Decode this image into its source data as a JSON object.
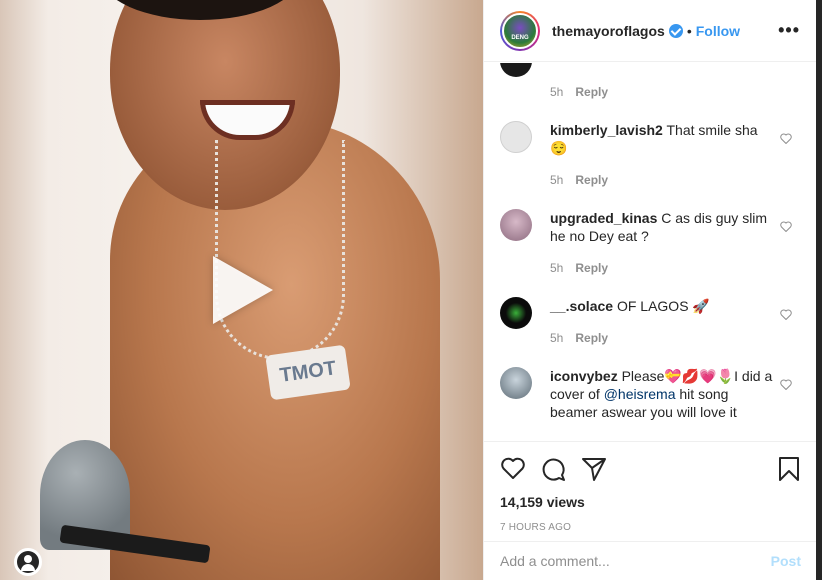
{
  "header": {
    "username": "themayoroflagos",
    "dot": "•",
    "follow_label": "Follow",
    "more_label": "•••",
    "avatar_text": "DENG"
  },
  "media": {
    "pendant_text": "TMOT"
  },
  "comments": [
    {
      "username": "",
      "text": "_",
      "time": "5h",
      "reply": "Reply"
    },
    {
      "username": "kimberly_lavish2",
      "text": "That smile sha 😌",
      "time": "5h",
      "reply": "Reply"
    },
    {
      "username": "upgraded_kinas",
      "text": "C as dis guy slim he no Dey eat ?",
      "time": "5h",
      "reply": "Reply"
    },
    {
      "username": "__.solace",
      "text": "OF LAGOS 🚀",
      "time": "5h",
      "reply": "Reply"
    },
    {
      "username": "iconvybez",
      "text_before": "Please💝💋💗🌷I did a cover of ",
      "mention": "@heisrema",
      "text_after": " hit song beamer aswear you will love it"
    }
  ],
  "stats": {
    "views": "14,159 views",
    "time_ago": "7 HOURS AGO"
  },
  "add_comment": {
    "placeholder": "Add a comment...",
    "post_label": "Post"
  },
  "colors": {
    "accent": "#3897f0",
    "muted": "#8e8e8e",
    "post_disabled": "#b2dffc"
  }
}
